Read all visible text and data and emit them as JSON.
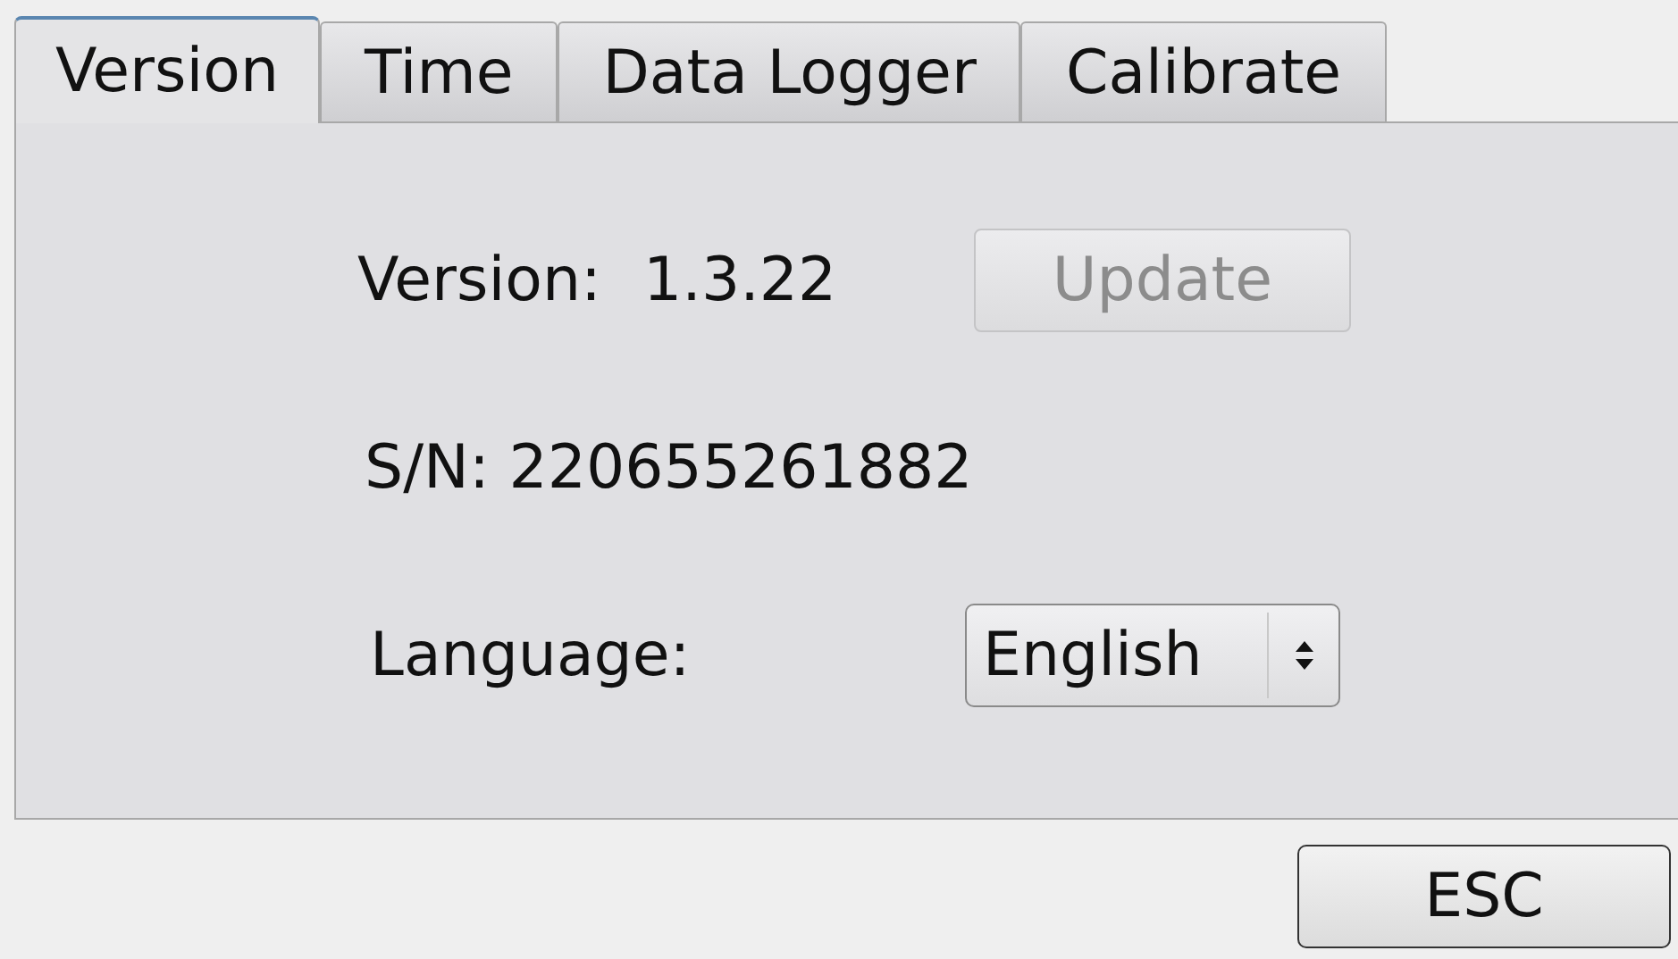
{
  "tabs": [
    {
      "label": "Version",
      "selected": true
    },
    {
      "label": "Time",
      "selected": false
    },
    {
      "label": "Data Logger",
      "selected": false
    },
    {
      "label": "Calibrate",
      "selected": false
    }
  ],
  "version": {
    "label": "Version:",
    "value": "1.3.22"
  },
  "update_button": {
    "label": "Update",
    "disabled": true
  },
  "serial": {
    "text": "S/N: 220655261882"
  },
  "language": {
    "label": "Language:",
    "value": "English"
  },
  "esc_button": {
    "label": "ESC"
  }
}
